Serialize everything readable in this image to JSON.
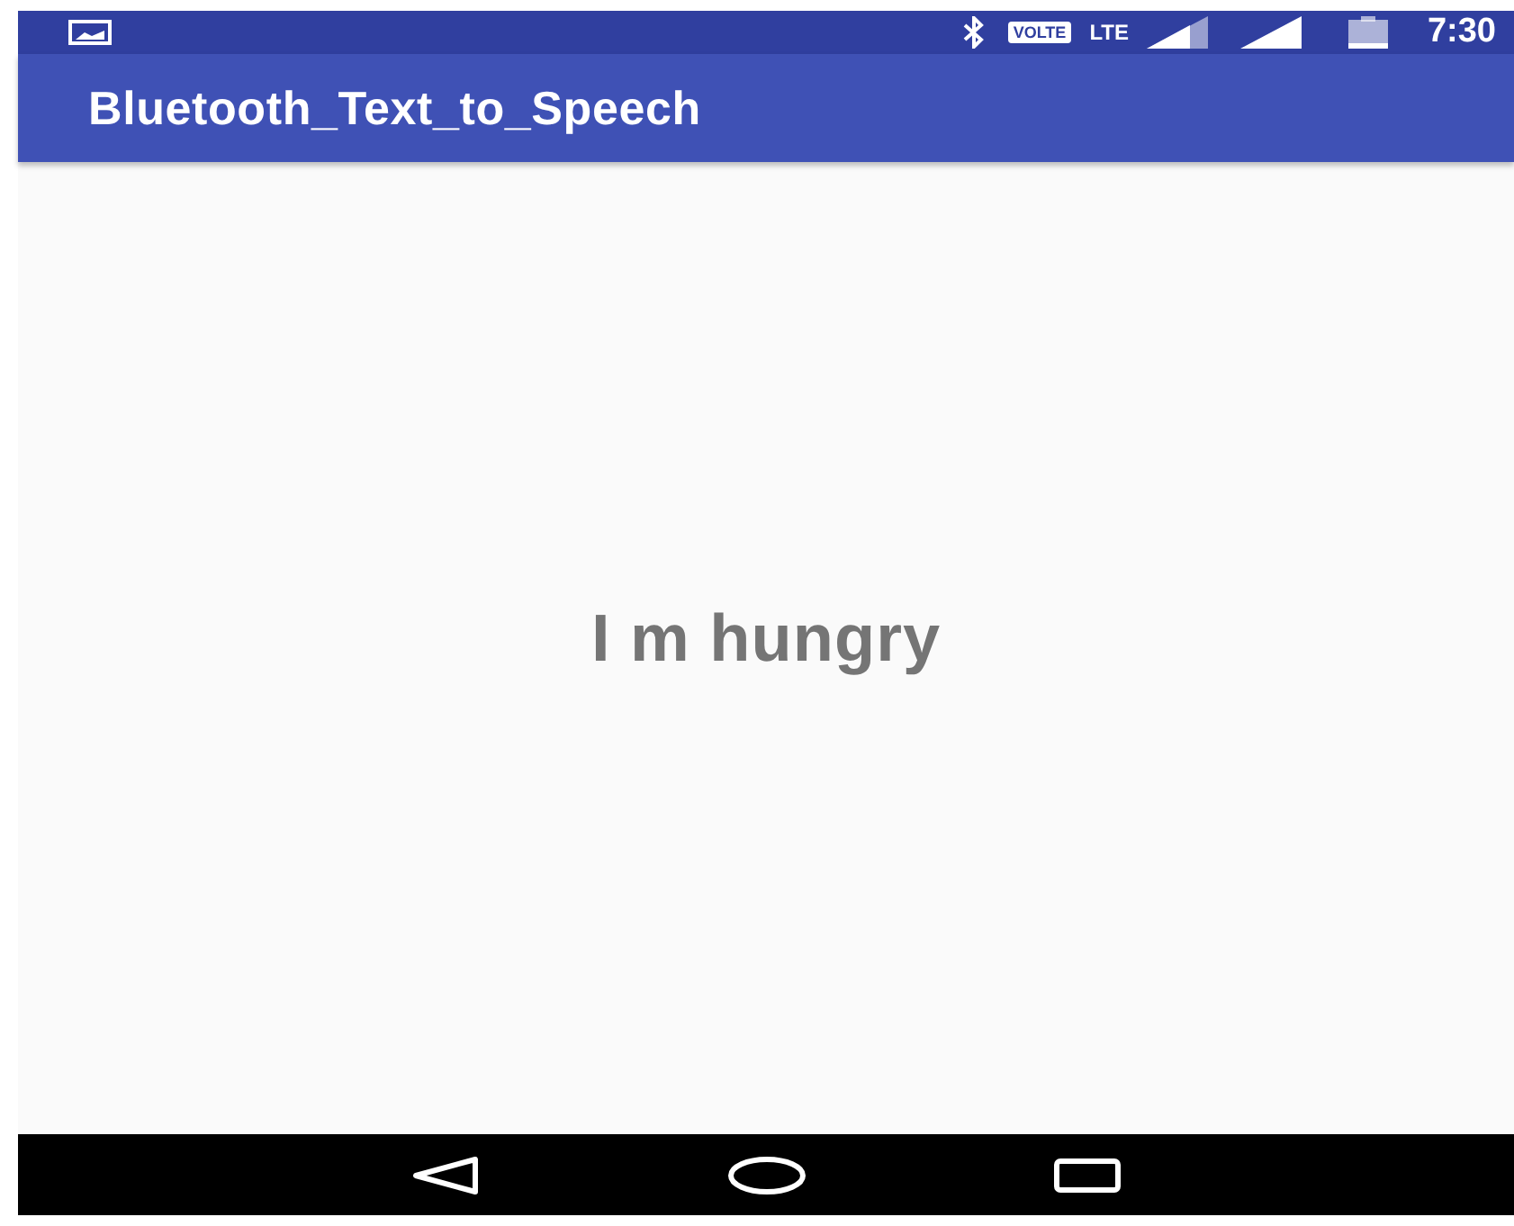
{
  "status_bar": {
    "volte": "VOLTE",
    "network": "LTE",
    "time": "7:30"
  },
  "app_bar": {
    "title": "Bluetooth_Text_to_Speech"
  },
  "content": {
    "message": "I m hungry"
  }
}
